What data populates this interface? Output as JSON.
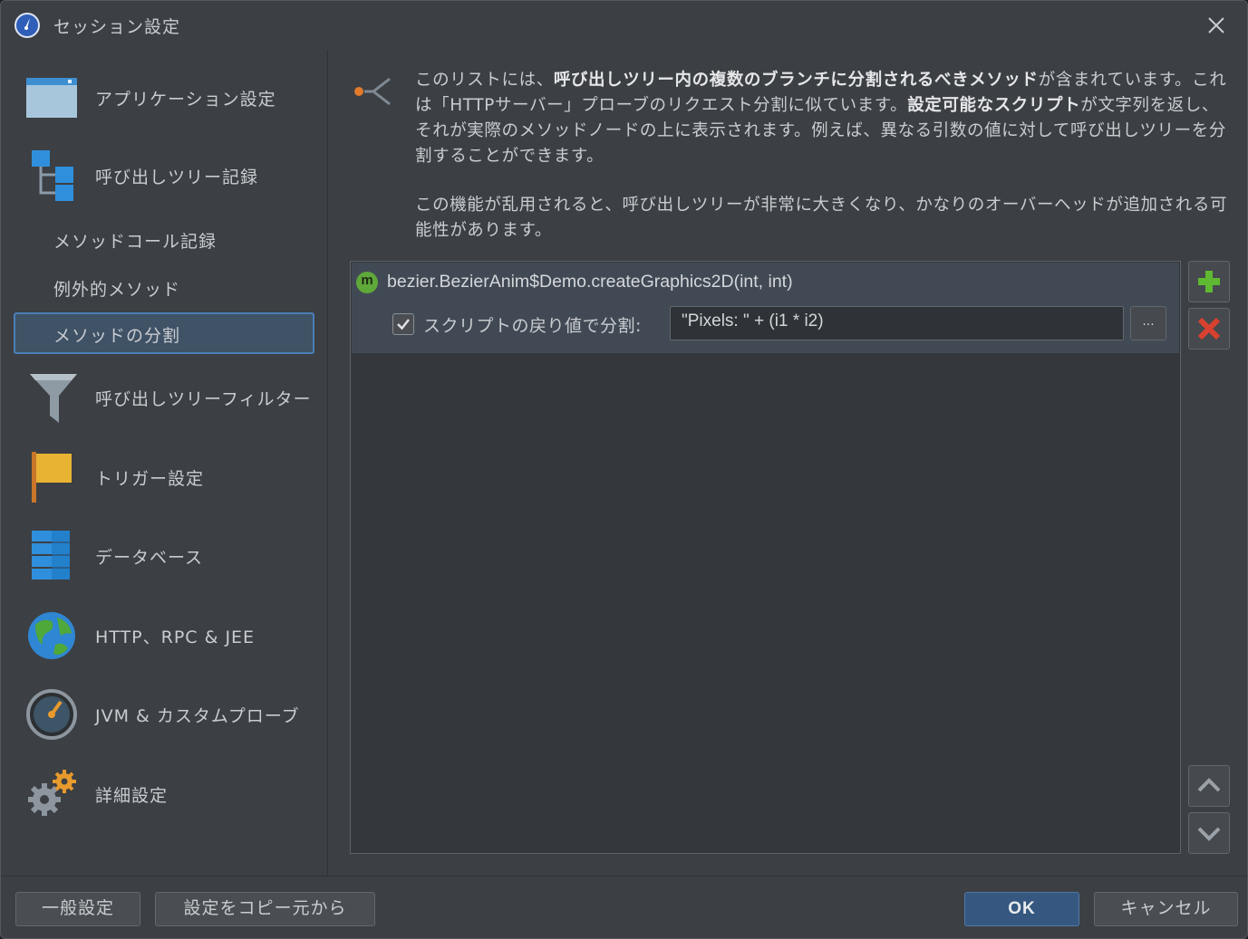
{
  "window": {
    "title": "セッション設定"
  },
  "sidebar": {
    "items": [
      {
        "label": "アプリケーション設定",
        "icon": "application-window-icon"
      },
      {
        "label": "呼び出しツリー記録",
        "icon": "call-tree-icon"
      },
      {
        "label": "呼び出しツリーフィルター",
        "icon": "funnel-icon"
      },
      {
        "label": "トリガー設定",
        "icon": "flag-icon"
      },
      {
        "label": "データベース",
        "icon": "database-icon"
      },
      {
        "label": "HTTP、RPC & JEE",
        "icon": "globe-icon"
      },
      {
        "label": "JVM & カスタムプローブ",
        "icon": "gauge-icon"
      },
      {
        "label": "詳細設定",
        "icon": "gears-icon"
      }
    ],
    "subitems": [
      {
        "label": "メソッドコール記録",
        "selected": false
      },
      {
        "label": "例外的メソッド",
        "selected": false
      },
      {
        "label": "メソッドの分割",
        "selected": true
      }
    ]
  },
  "main": {
    "description": {
      "p1_a": "このリストには、",
      "p1_b": "呼び出しツリー内の複数のブランチに分割されるべきメソッド",
      "p1_c": "が含まれています。これは「HTTPサーバー」プローブのリクエスト分割に似ています。",
      "p1_d": "設定可能なスクリプト",
      "p1_e": "が文字列を返し、それが実際のメソッドノードの上に表示されます。例えば、異なる引数の値に対して呼び出しツリーを分割することができます。",
      "p2": "この機能が乱用されると、呼び出しツリーが非常に大きくなり、かなりのオーバーヘッドが追加される可能性があります。"
    },
    "list": {
      "rows": [
        {
          "badge": "m",
          "method": "bezier.BezierAnim$Demo.createGraphics2D(int, int)",
          "checkbox_checked": true,
          "script_label": "スクリプトの戻り値で分割:",
          "script_value": "\"Pixels: \" + (i1 * i2)",
          "ellipsis": "..."
        }
      ]
    },
    "colors": {
      "add": "#5fb832",
      "remove": "#d8412f",
      "method_badge": "#5fa83a"
    }
  },
  "footer": {
    "general_settings": "一般設定",
    "copy_settings": "設定をコピー元から",
    "ok": "OK",
    "cancel": "キャンセル"
  }
}
